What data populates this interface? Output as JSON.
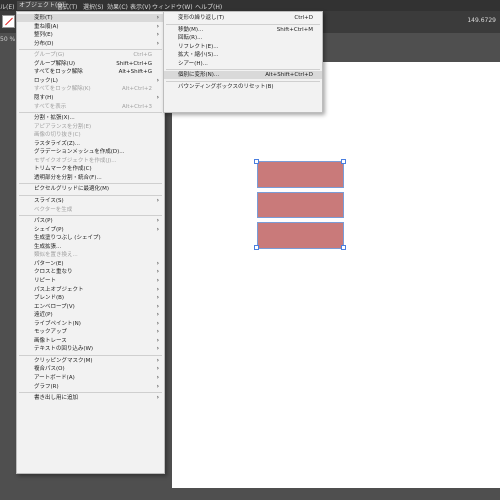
{
  "menubar": [
    "ル(E)",
    "オブジェクト(O)",
    "書式(T)",
    "選択(S)",
    "効果(C)",
    "表示(V)",
    "ウィンドウ(W)",
    "ヘルプ(H)"
  ],
  "toolbar": {
    "coord": "149.6729"
  },
  "doc_tab": "50 %",
  "object_menu": [
    {
      "label": "変形(T)",
      "arrow": true,
      "hl": true
    },
    {
      "label": "重ね順(A)",
      "arrow": true
    },
    {
      "label": "整列(E)",
      "arrow": true
    },
    {
      "label": "分布(D)",
      "arrow": true
    },
    {
      "sep": true
    },
    {
      "label": "グループ(G)",
      "shortcut": "Ctrl+G",
      "dis": true
    },
    {
      "label": "グループ解除(U)",
      "shortcut": "Shift+Ctrl+G"
    },
    {
      "label": "すべてをロック解除",
      "shortcut": "Alt+Shift+G"
    },
    {
      "label": "ロック(L)",
      "arrow": true
    },
    {
      "label": "すべてをロック解除(K)",
      "shortcut": "Alt+Ctrl+2",
      "dis": true
    },
    {
      "label": "隠す(H)",
      "arrow": true
    },
    {
      "label": "すべてを表示",
      "shortcut": "Alt+Ctrl+3",
      "dis": true
    },
    {
      "sep": true
    },
    {
      "label": "分割・拡張(X)..."
    },
    {
      "label": "アピアランスを分割(E)",
      "dis": true
    },
    {
      "label": "画像の切り抜き(C)",
      "dis": true
    },
    {
      "label": "ラスタライズ(Z)..."
    },
    {
      "label": "グラデーションメッシュを作成(D)..."
    },
    {
      "label": "モザイクオブジェクトを作成(J)...",
      "dis": true
    },
    {
      "label": "トリムマークを作成(C)"
    },
    {
      "label": "透明部分を分割・統合(F)..."
    },
    {
      "sep": true
    },
    {
      "label": "ピクセルグリッドに最適化(M)"
    },
    {
      "sep": true
    },
    {
      "label": "スライス(S)",
      "arrow": true
    },
    {
      "label": "ベクターを生成",
      "dis": true
    },
    {
      "sep": true
    },
    {
      "label": "パス(P)",
      "arrow": true
    },
    {
      "label": "シェイプ(P)",
      "arrow": true
    },
    {
      "label": "生成塗りつぶし (シェイプ)"
    },
    {
      "label": "生成拡張..."
    },
    {
      "label": "類似を置き換え...",
      "dis": true
    },
    {
      "label": "パターン(E)",
      "arrow": true
    },
    {
      "label": "クロスと重なり",
      "arrow": true
    },
    {
      "label": "リピート",
      "arrow": true
    },
    {
      "label": "パス上オブジェクト",
      "arrow": true
    },
    {
      "label": "ブレンド(B)",
      "arrow": true
    },
    {
      "label": "エンベロープ(V)",
      "arrow": true
    },
    {
      "label": "遠近(P)",
      "arrow": true
    },
    {
      "label": "ライブペイント(N)",
      "arrow": true
    },
    {
      "label": "モックアップ",
      "arrow": true
    },
    {
      "label": "画像トレース",
      "arrow": true
    },
    {
      "label": "テキストの回り込み(W)",
      "arrow": true
    },
    {
      "sep": true
    },
    {
      "label": "クリッピングマスク(M)",
      "arrow": true
    },
    {
      "label": "複合パス(O)",
      "arrow": true
    },
    {
      "label": "アートボード(A)",
      "arrow": true
    },
    {
      "label": "グラフ(R)",
      "arrow": true
    },
    {
      "sep": true
    },
    {
      "label": "書き出し用に追加",
      "arrow": true
    }
  ],
  "transform_menu": [
    {
      "label": "変形の繰り返し(T)",
      "shortcut": "Ctrl+D"
    },
    {
      "sep": true
    },
    {
      "label": "移動(M)...",
      "shortcut": "Shift+Ctrl+M"
    },
    {
      "label": "回転(R)..."
    },
    {
      "label": "リフレクト(E)..."
    },
    {
      "label": "拡大・縮小(S)..."
    },
    {
      "label": "シアー(H)..."
    },
    {
      "sep": true
    },
    {
      "label": "個別に変形(N)...",
      "shortcut": "Alt+Shift+Ctrl+D",
      "hl": true
    },
    {
      "sep": true
    },
    {
      "label": "バウンディングボックスのリセット(B)"
    }
  ],
  "colors": {
    "shape_fill": "#c97a7a",
    "selection": "#4a7fe0"
  }
}
